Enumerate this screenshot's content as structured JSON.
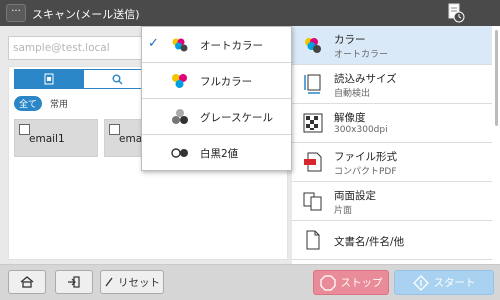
{
  "header": {
    "menu_label": "···",
    "title": "スキャン(メール送信)",
    "icon": "document-clock-icon"
  },
  "address": {
    "placeholder": "sample@test.local"
  },
  "addressbook": {
    "tabs": [
      {
        "icon": "addressbook-icon",
        "active": true
      },
      {
        "icon": "search-icon",
        "active": false
      }
    ],
    "filters": {
      "all_label": "全て",
      "common_label": "常用"
    },
    "entries": [
      {
        "label": "email1"
      },
      {
        "label": "email2"
      }
    ]
  },
  "color_dropdown": {
    "items": [
      {
        "label": "オートカラー",
        "selected": true,
        "icon": "auto-color-icon"
      },
      {
        "label": "フルカラー",
        "selected": false,
        "icon": "full-color-icon"
      },
      {
        "label": "グレースケール",
        "selected": false,
        "icon": "grayscale-icon"
      },
      {
        "label": "白黒2値",
        "selected": false,
        "icon": "black-white-icon"
      }
    ]
  },
  "settings": [
    {
      "label": "カラー",
      "value": "オートカラー",
      "icon": "color-icon",
      "active": true
    },
    {
      "label": "読込みサイズ",
      "value": "自動検出",
      "icon": "scan-size-icon",
      "active": false
    },
    {
      "label": "解像度",
      "value": "300x300dpi",
      "icon": "resolution-icon",
      "active": false
    },
    {
      "label": "ファイル形式",
      "value": "コンパクトPDF",
      "icon": "file-format-icon",
      "active": false
    },
    {
      "label": "両面設定",
      "value": "片面",
      "icon": "duplex-icon",
      "active": false
    },
    {
      "label": "文書名/件名/他",
      "value": "",
      "icon": "document-name-icon",
      "active": false
    }
  ],
  "footer": {
    "home_icon": "home-icon",
    "logout_icon": "logout-icon",
    "reset_label": "リセット",
    "stop_label": "ストップ",
    "start_label": "スタート"
  },
  "colors": {
    "header_bg": "#4a4a4a",
    "accent": "#2b86c7",
    "active_row": "#d9e9f7",
    "stop": "#e98b98",
    "start": "#a9d2f1"
  }
}
